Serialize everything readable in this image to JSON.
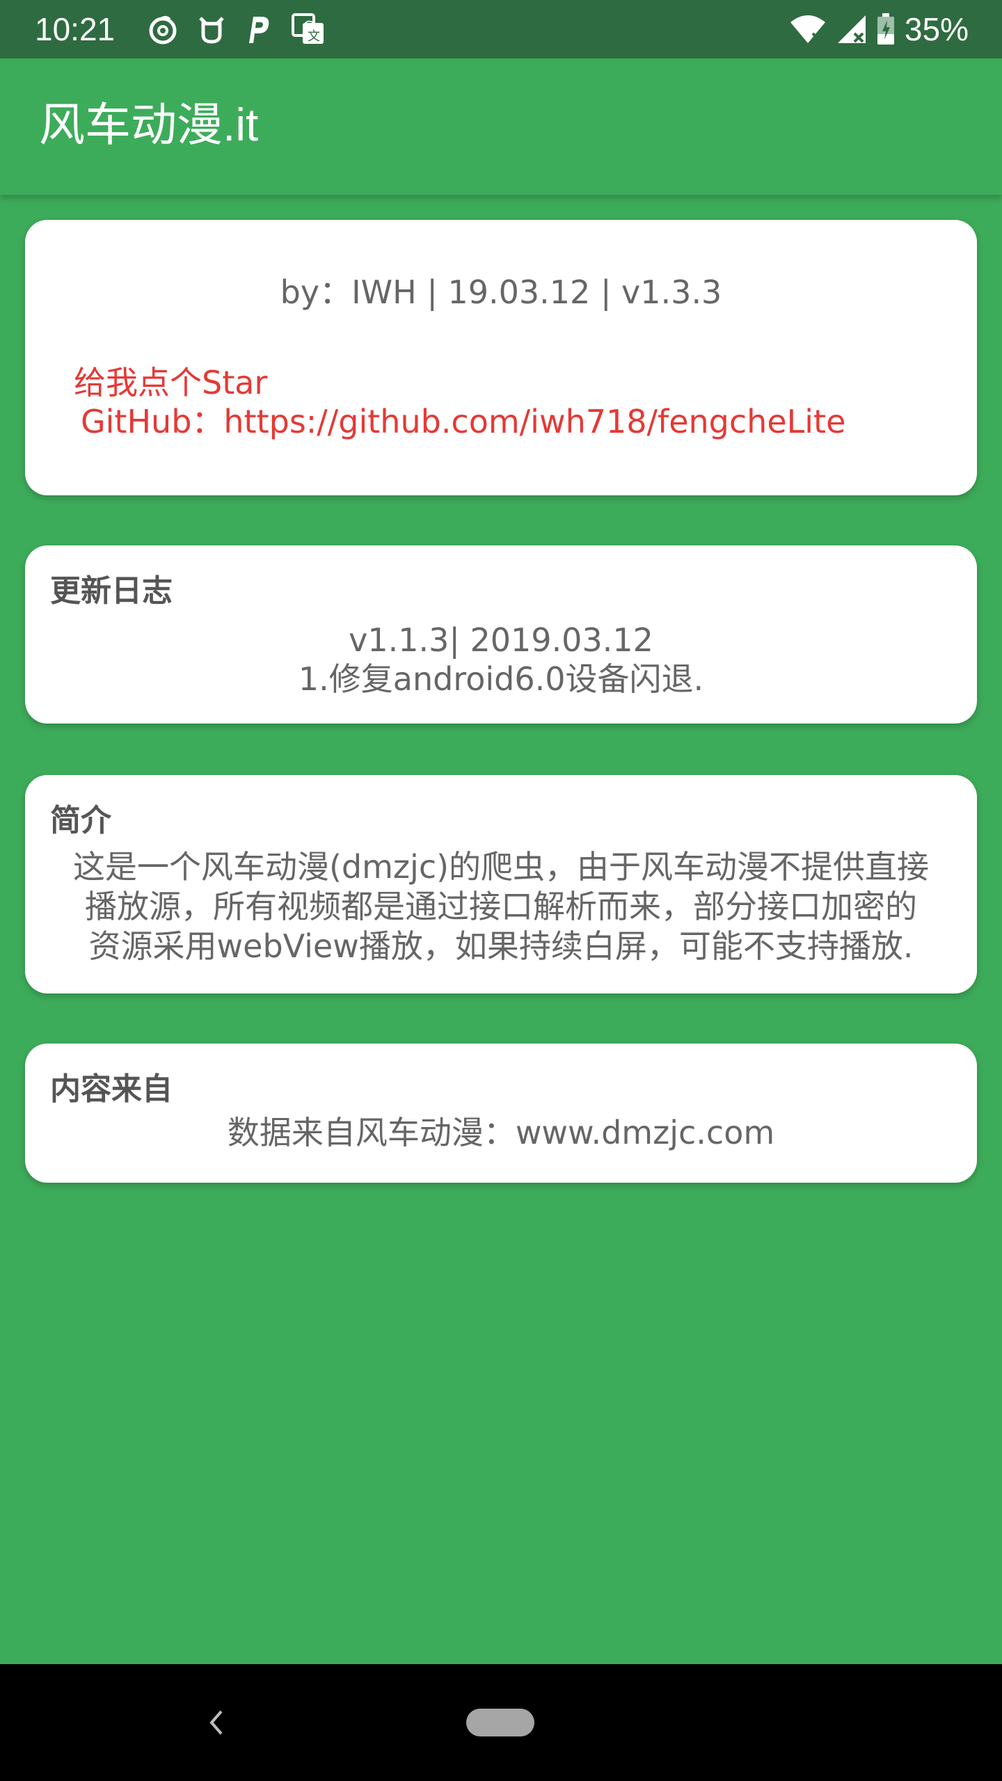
{
  "status_bar": {
    "time": "10:21",
    "left_icons": [
      "netease-music-icon",
      "notification-app-icon",
      "paypal-icon",
      "translate-icon"
    ],
    "right_icons": [
      "wifi-icon",
      "cell-signal-icon",
      "battery-icon"
    ],
    "battery_percent": "35%"
  },
  "app_bar": {
    "title": "风车动漫.it"
  },
  "about_card": {
    "byline": "by：IWH | 19.03.12 | v1.3.3",
    "star_line": "给我点个Star",
    "github_line": "GitHub：https://github.com/iwh718/fengcheLite"
  },
  "changelog_card": {
    "title": "更新日志",
    "version_line": "v1.1.3| 2019.03.12",
    "change_line": "1.修复android6.0设备闪退."
  },
  "intro_card": {
    "title": "简介",
    "lines": [
      "这是一个风车动漫(dmzjc)的爬虫，由于风车动漫不提供直接",
      "播放源，所有视频都是通过接口解析而来，部分接口加密的",
      "资源采用webView播放，如果持续白屏，可能不支持播放."
    ]
  },
  "source_card": {
    "title": "内容来自",
    "text": "数据来自风车动漫：www.dmzjc.com"
  },
  "colors": {
    "status_bar": "#2f6b40",
    "primary": "#3dac5a",
    "link": "#e53935",
    "text": "#666666"
  }
}
